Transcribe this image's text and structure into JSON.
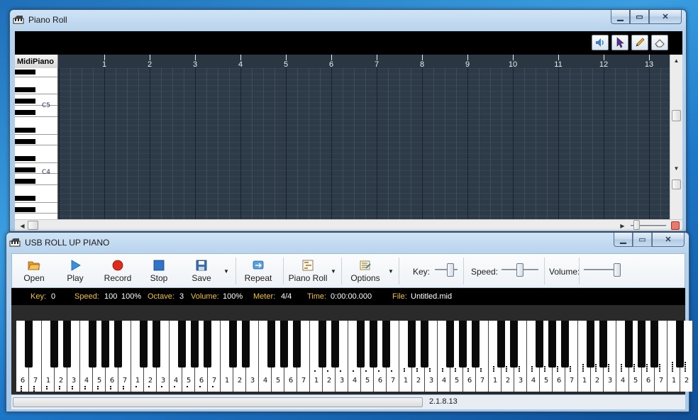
{
  "piano_roll": {
    "title": "Piano Roll",
    "keys_header": "MidiPiano",
    "octave_labels": [
      "C5",
      "C4"
    ],
    "ruler": [
      "1",
      "2",
      "3",
      "4",
      "5",
      "6",
      "7",
      "8",
      "9",
      "10",
      "11",
      "12",
      "13"
    ],
    "tools": [
      "speaker-icon",
      "pointer-icon",
      "pencil-icon",
      "eraser-icon"
    ]
  },
  "main": {
    "title": "USB ROLL UP PIANO",
    "toolbar": {
      "open": "Open",
      "play": "Play",
      "record": "Record",
      "stop": "Stop",
      "save": "Save",
      "repeat": "Repeat",
      "piano_roll": "Piano Roll",
      "options": "Options",
      "key_label": "Key:",
      "speed_label": "Speed:",
      "volume_label": "Volume:"
    },
    "sliders": {
      "key": 0.5,
      "speed": 0.5,
      "volume": 1.0
    },
    "status": {
      "key_label": "Key:",
      "key_value": "0",
      "speed_label": "Speed:",
      "speed_value": "100",
      "speed_pct": "100%",
      "octave_label": "Octave:",
      "octave_value": "3",
      "volume_label": "Volume:",
      "volume_value": "100%",
      "meter_label": "Meter:",
      "meter_value": "4/4",
      "time_label": "Time:",
      "time_value": "0:00:00.000",
      "file_label": "File:",
      "file_value": "Untitled.mid"
    },
    "keyboard": {
      "white_key_labels": [
        "6",
        "7",
        "1",
        "2",
        "3",
        "4",
        "5",
        "6",
        "7",
        "1",
        "2",
        "3",
        "4",
        "5",
        "6",
        "7",
        "1",
        "2",
        "3",
        "4",
        "5",
        "6",
        "7",
        "1",
        "2",
        "3",
        "4",
        "5",
        "6",
        "7",
        "1",
        "2",
        "3",
        "4",
        "5",
        "6",
        "7",
        "1",
        "2",
        "3",
        "4",
        "5",
        "6",
        "7",
        "1",
        "2",
        "3",
        "4",
        "5",
        "6",
        "7",
        "1",
        "2"
      ]
    },
    "version": "2.1.8.13",
    "colors": {
      "status_label": "#f2c230",
      "status_value": "#ffffff",
      "grid_bg": "#2c3b47"
    }
  }
}
